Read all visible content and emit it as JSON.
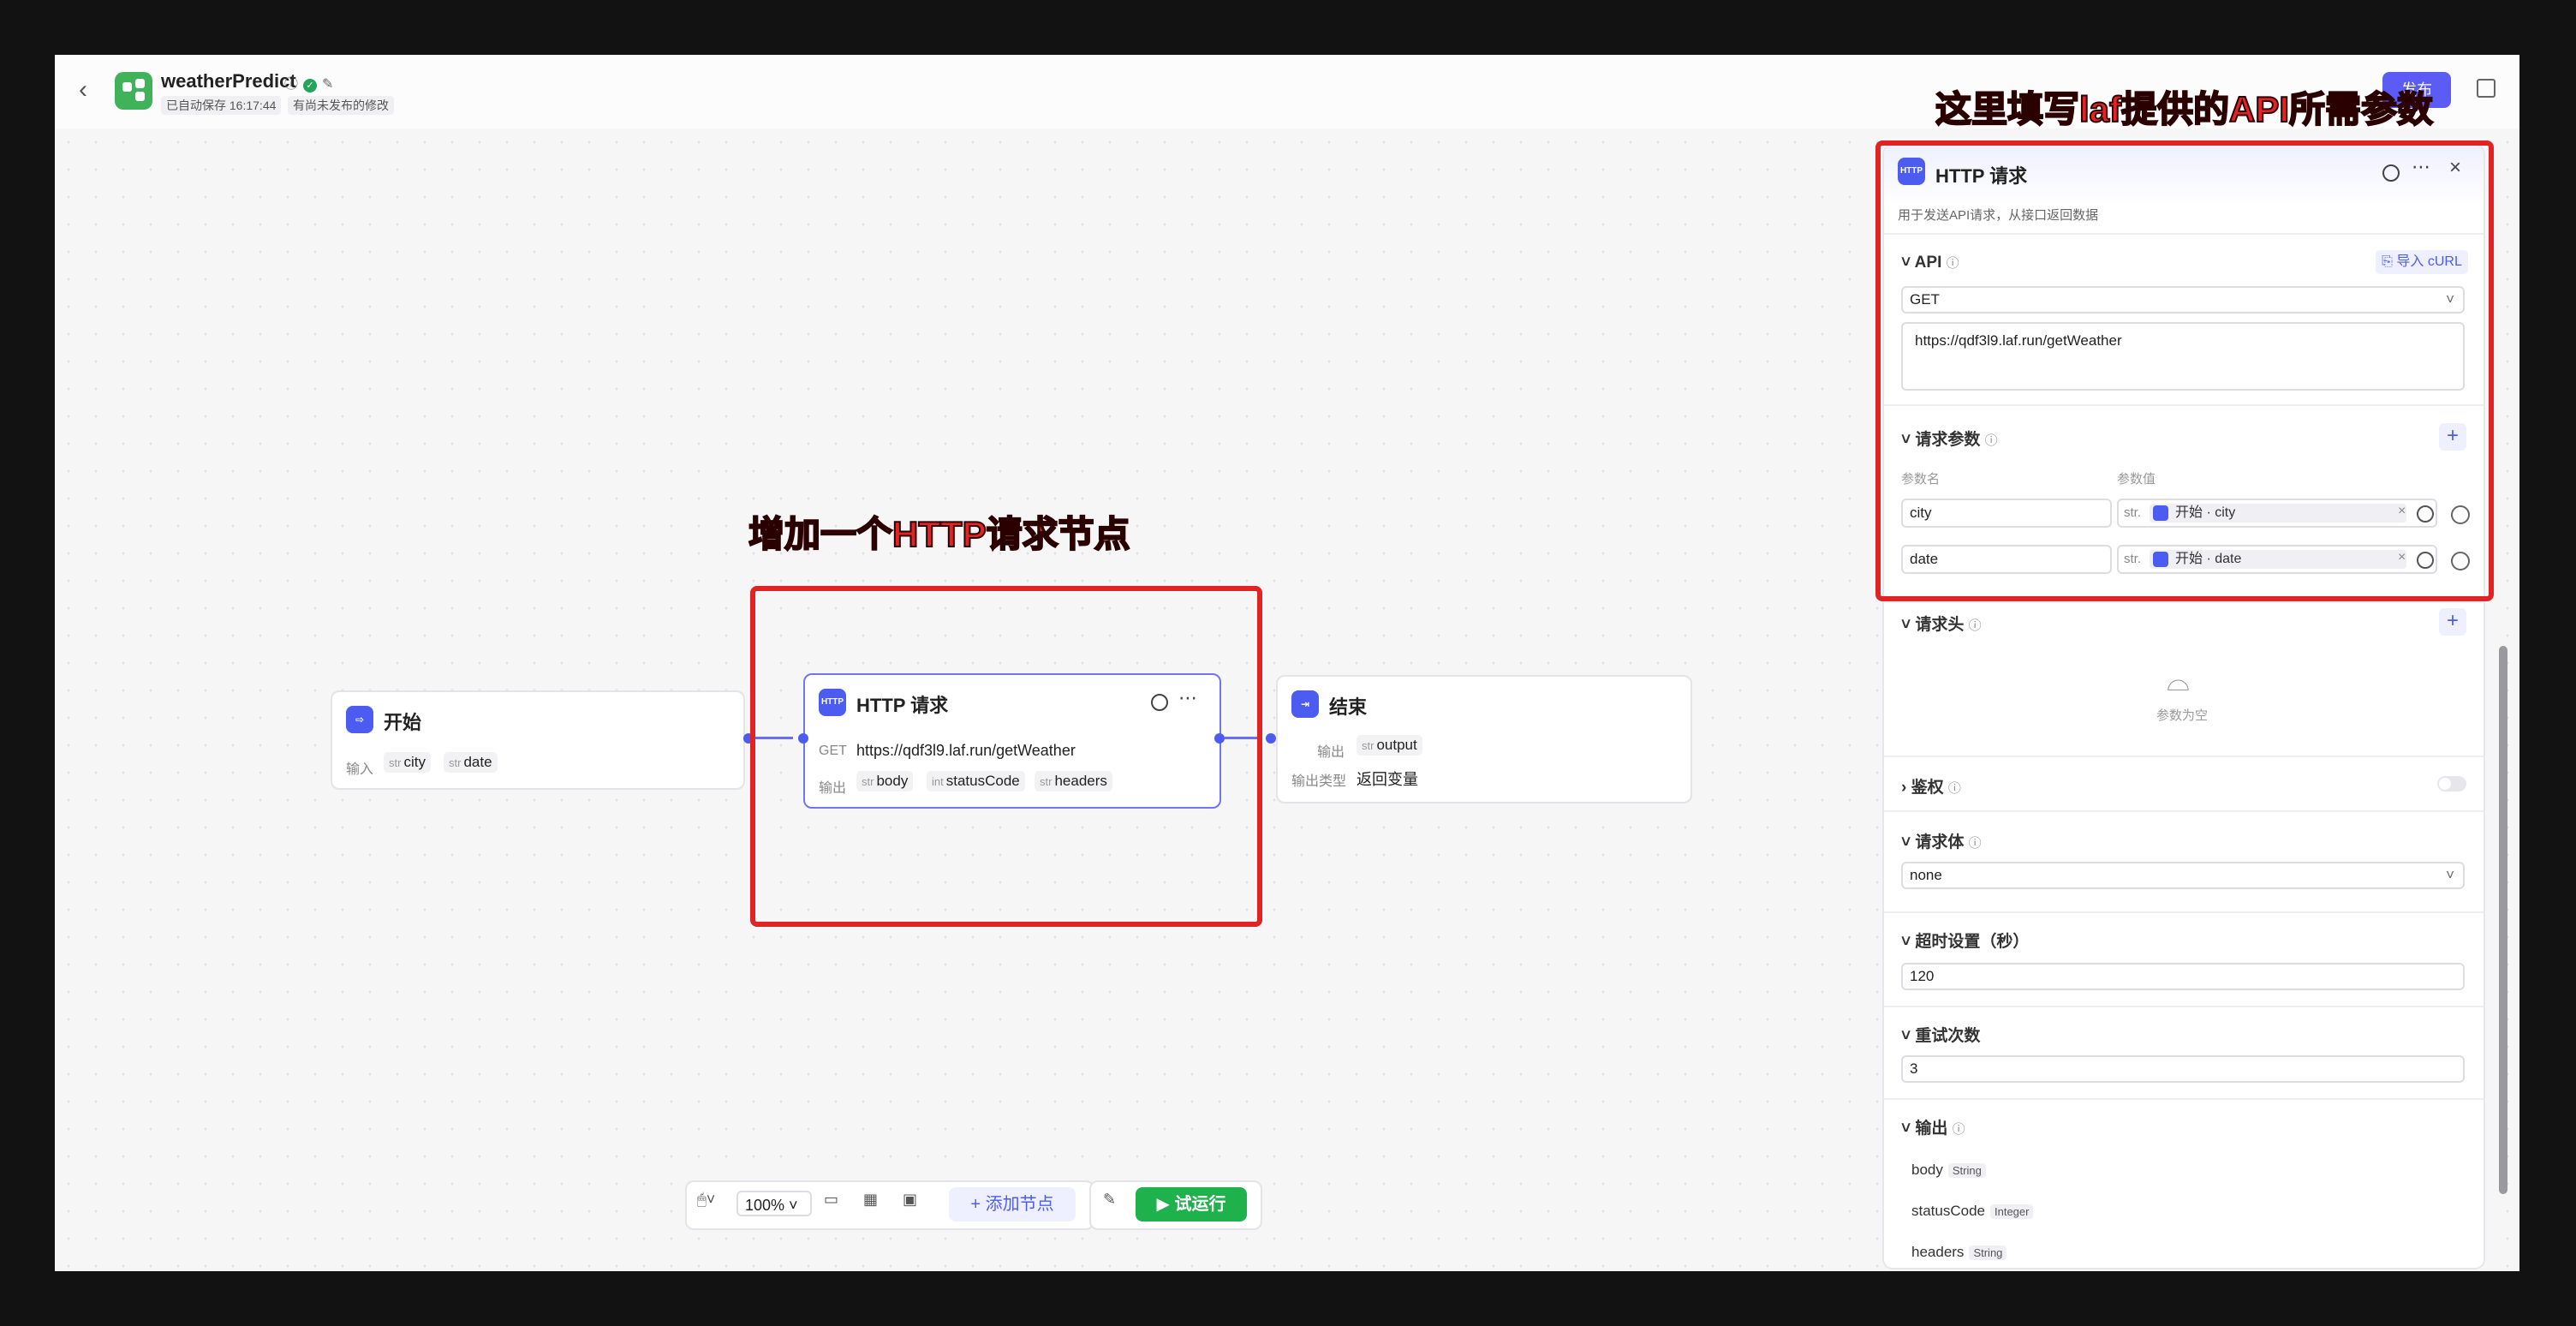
{
  "header": {
    "back_icon": "chevron-left-icon",
    "app_title": "weatherPredict",
    "autosave": "已自动保存 16:17:44",
    "unpublished": "有尚未发布的修改",
    "publish_label": "发布"
  },
  "annotations": {
    "top": "这里填写laf提供的API所需参数",
    "mid": "增加一个HTTP请求节点",
    "color": "#e32424"
  },
  "nodes": {
    "start": {
      "title": "开始",
      "input_label": "输入",
      "params": [
        {
          "type": "str",
          "name": "city"
        },
        {
          "type": "str",
          "name": "date"
        }
      ]
    },
    "http": {
      "title": "HTTP 请求",
      "method": "GET",
      "url": "https://qdf3l9.laf.run/getWeather",
      "output_label": "输出",
      "outputs": [
        {
          "type": "str",
          "name": "body"
        },
        {
          "type": "int",
          "name": "statusCode"
        },
        {
          "type": "str",
          "name": "headers"
        }
      ]
    },
    "end": {
      "title": "结束",
      "output_label": "输出",
      "output": {
        "type": "str",
        "name": "output"
      },
      "output_type_label": "输出类型",
      "output_type_value": "返回变量"
    }
  },
  "toolbar": {
    "zoom": "100%",
    "add_node": "添加节点",
    "run": "试运行"
  },
  "panel": {
    "title": "HTTP 请求",
    "description": "用于发送API请求，从接口返回数据",
    "api_label": "API",
    "import_curl": "导入 cURL",
    "method": "GET",
    "url": "https://qdf3l9.laf.run/getWeather",
    "params_label": "请求参数",
    "param_name_header": "参数名",
    "param_value_header": "参数值",
    "params": [
      {
        "name": "city",
        "type": "str.",
        "ref": "开始 · city"
      },
      {
        "name": "date",
        "type": "str.",
        "ref": "开始 · date"
      }
    ],
    "headers_label": "请求头",
    "headers_empty": "参数为空",
    "auth_label": "鉴权",
    "body_label": "请求体",
    "body_value": "none",
    "timeout_label": "超时设置（秒）",
    "timeout_value": "120",
    "retry_label": "重试次数",
    "retry_value": "3",
    "output_label": "输出",
    "outputs": [
      {
        "name": "body",
        "type": "String"
      },
      {
        "name": "statusCode",
        "type": "Integer"
      },
      {
        "name": "headers",
        "type": "String"
      }
    ]
  },
  "colors": {
    "accent": "#4d5cf0",
    "run": "#1fb14b",
    "annotation": "#e02424"
  }
}
